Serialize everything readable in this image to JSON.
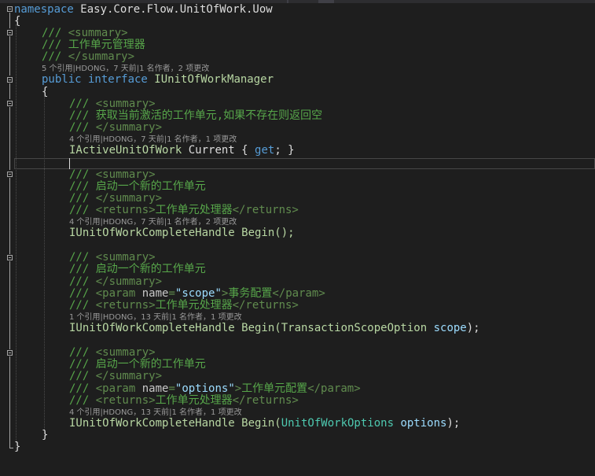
{
  "editor": {
    "namespace_kw": "namespace",
    "namespace_name": " Easy.Core.Flow.UnitOfWork.Uow",
    "open_brace": "{",
    "close_brace": "}",
    "iface_open": "{",
    "iface_close": "}",
    "doc_prefix": "/// ",
    "summary_open": "<summary>",
    "summary_close": "</summary>",
    "returns_open": "<returns>",
    "returns_close": "</returns>",
    "param_open": "<param ",
    "param_attr": "name",
    "param_eq": "=",
    "param_close": "</param>",
    "iface_summary": "工作单元管理器",
    "iface_lens": "5 个引用|HDONG，7 天前|1 名作者，2 项更改",
    "public_kw": "public",
    "interface_kw": " interface ",
    "iface_name": "IUnitOfWorkManager",
    "m1_summary": "获取当前激活的工作单元,如果不存在则返回空",
    "m1_lens": "4 个引用|HDONG，7 天前|1 名作者，1 项更改",
    "m1_type": "IActiveUnitOfWork",
    "m1_name": " Current { ",
    "m1_get": "get",
    "m1_end": "; }",
    "m2_summary": "启动一个新的工作单元",
    "m2_returns": "工作单元处理器",
    "m2_lens": "4 个引用|HDONG，7 天前|1 名作者，2 项更改",
    "m2_sig": "IUnitOfWorkCompleteHandle Begin();",
    "m3_summary": "启动一个新的工作单元",
    "m3_param_name": "\"scope\"",
    "m3_param_desc": "事务配置",
    "m3_returns": "工作单元处理器",
    "m3_lens": "1 个引用|HDONG，13 天前|1 名作者，1 项更改",
    "m3_sig_a": "IUnitOfWorkCompleteHandle Begin(TransactionScopeOption ",
    "m3_sig_param": "scope",
    "m3_sig_b": ");",
    "m4_summary": "启动一个新的工作单元",
    "m4_param_name": "\"options\"",
    "m4_param_desc": "工作单元配置",
    "m4_returns": "工作单元处理器",
    "m4_lens": "4 个引用|HDONG，13 天前|1 名作者，1 项更改",
    "m4_sig_a": "IUnitOfWorkCompleteHandle Begin(",
    "m4_sig_type": "UnitOfWorkOptions",
    "m4_sig_sp": " ",
    "m4_sig_param": "options",
    "m4_sig_b": ");"
  },
  "colors": {
    "background": "#1e1e1e",
    "comment": "#57a64a",
    "keyword": "#569cd6",
    "interface_type": "#b8d7a3",
    "class_type": "#4ec9b0",
    "parameter": "#9cdcfe",
    "string": "#d69d85",
    "codelens": "#999999"
  }
}
